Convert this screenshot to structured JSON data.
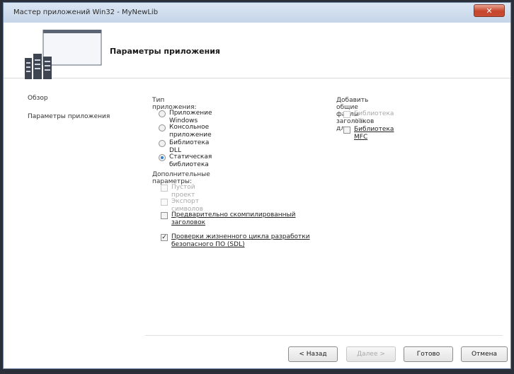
{
  "window": {
    "title": "Мастер приложений Win32 - MyNewLib"
  },
  "header": {
    "title": "Параметры приложения"
  },
  "nav": {
    "items": [
      "Обзор",
      "Параметры приложения"
    ]
  },
  "app_type": {
    "label": "Тип приложения:",
    "options": [
      {
        "label": "Приложение Windows",
        "checked": false
      },
      {
        "label": "Консольное приложение",
        "checked": false
      },
      {
        "label": "Библиотека DLL",
        "checked": false
      },
      {
        "label": "Статическая библиотека",
        "checked": true
      }
    ]
  },
  "extra": {
    "label": "Дополнительные параметры:",
    "options": [
      {
        "label": "Пустой проект",
        "checked": false,
        "enabled": false
      },
      {
        "label": "Экспорт символов",
        "checked": false,
        "enabled": false
      },
      {
        "label": "Предварительно скомпилированный заголовок",
        "checked": false,
        "enabled": true
      },
      {
        "label": "Проверки жизненного цикла разработки безопасного ПО (SDL)",
        "checked": true,
        "enabled": true
      }
    ]
  },
  "headers": {
    "label": "Добавить общие файлы заголовков для:",
    "options": [
      {
        "label": "Библиотека ATL",
        "checked": false,
        "enabled": false
      },
      {
        "label": "Библиотека MFC",
        "checked": false,
        "enabled": true
      }
    ]
  },
  "buttons": {
    "back": "< Назад",
    "next": "Далее >",
    "finish": "Готово",
    "cancel": "Отмена"
  },
  "close_glyph": "✕"
}
